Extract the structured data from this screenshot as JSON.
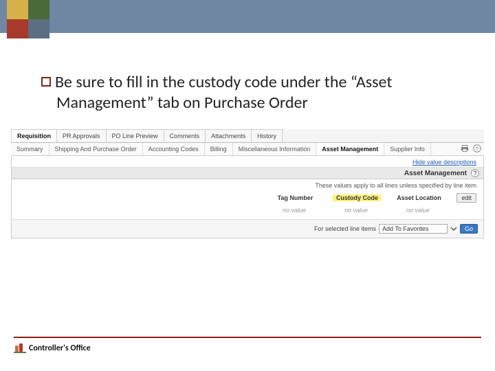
{
  "bullet_text_1": "Be sure to fill in the custody code under the “Asset",
  "bullet_text_2": "Management” tab on Purchase Order",
  "tabs": {
    "requisition": "Requisition",
    "pr_approvals": "PR Approvals",
    "po_line_preview": "PO Line Preview",
    "comments": "Comments",
    "attachments": "Attachments",
    "history": "History"
  },
  "subtabs": {
    "summary": "Summary",
    "shipping": "Shipping And Purchase Order",
    "accounting": "Accounting Codes",
    "billing": "Billing",
    "misc": "Miscellaneous Information",
    "asset_mgmt": "Asset Management",
    "supplier": "Supplier Info"
  },
  "links": {
    "hide_desc": "Hide value descriptions"
  },
  "section": {
    "title": "Asset Management",
    "help": "?",
    "note": "These values apply to all lines unless specified by line item",
    "cols": {
      "tag": "Tag Number",
      "custody": "Custody Code",
      "location": "Asset Location"
    },
    "edit": "edit",
    "no_value": "no value"
  },
  "footer": {
    "label": "For selected line items",
    "select": "Add To Favorites",
    "go": "Go"
  },
  "slide_footer": "Controller's Office"
}
